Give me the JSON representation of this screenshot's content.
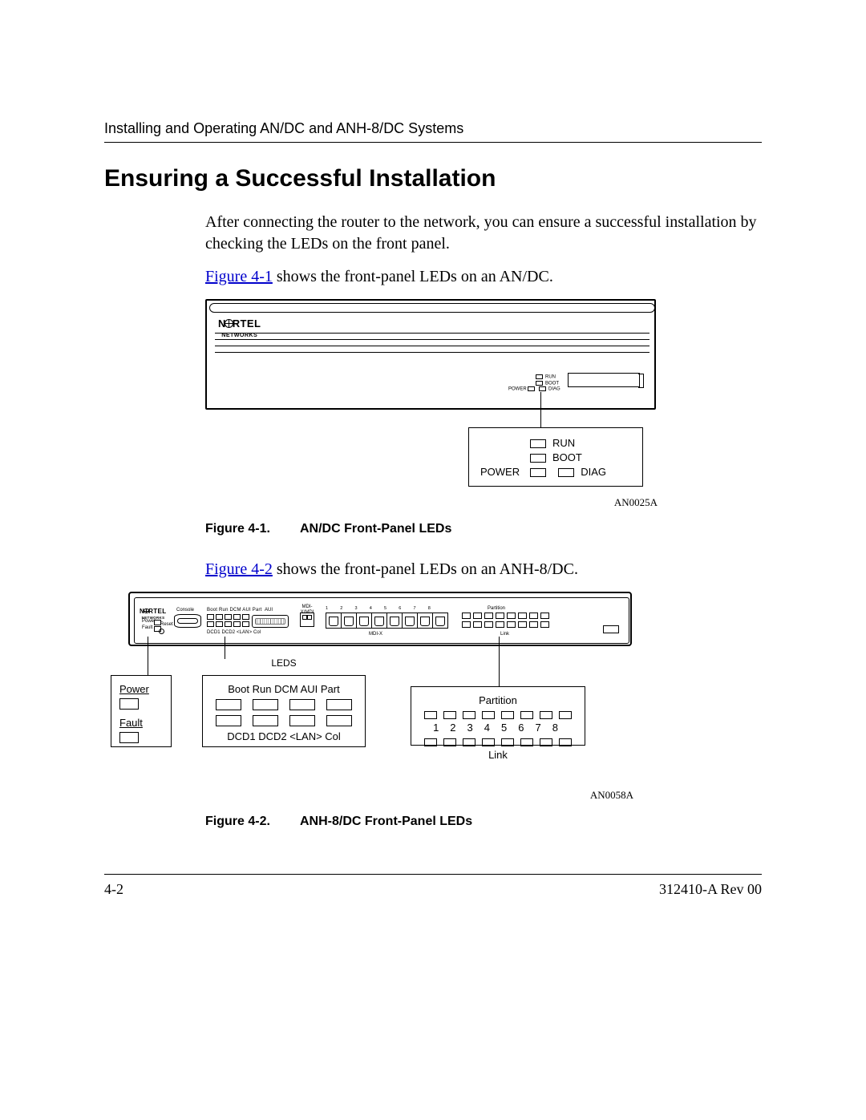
{
  "header": {
    "running_title": "Installing and Operating AN/DC and ANH-8/DC Systems"
  },
  "heading": "Ensuring a Successful Installation",
  "para1": "After connecting the router to the network, you can ensure a successful installation by checking the LEDs on the front panel.",
  "para2_pre_link": "",
  "para2_link": "Figure 4-1",
  "para2_post_link": " shows the front-panel LEDs on an AN/DC.",
  "para3_link": "Figure 4-2",
  "para3_post_link": " shows the front-panel LEDs on an ANH-8/DC.",
  "fig41": {
    "brand_line1_a": "N",
    "brand_line1_b": "RTEL",
    "brand_line2": "NETWORKS",
    "micro_power": "POWER",
    "micro_run": "RUN",
    "micro_boot": "BOOT",
    "micro_diag": "DIAG",
    "callout_power": "POWER",
    "callout_run": "RUN",
    "callout_boot": "BOOT",
    "callout_diag": "DIAG",
    "artcode": "AN0025A",
    "caption_num": "Figure 4-1.",
    "caption_text": "AN/DC Front-Panel LEDs"
  },
  "fig42": {
    "brand_line1_a": "N",
    "brand_line1_b": "RTEL",
    "brand_line2": "NETWORKS",
    "lbl_console": "Console",
    "lbl_power": "Power",
    "lbl_fault": "Fault",
    "lbl_reset": "Reset",
    "lbl_tiny_top": "Boot Run DCM AUI Part",
    "lbl_tiny_bot": "DCD1 DCD2 <LAN> Col",
    "lbl_aui": "AUI",
    "lbl_mdix": "MDI-X/MDI",
    "lbl_mdix_bar": "MDI-X",
    "rj_numbers": "12345678",
    "lbl_partition": "Partition",
    "lbl_link": "Link",
    "leds_title": "LEDS",
    "co_left_power": "Power",
    "co_left_fault": "Fault",
    "co_mid_top": "Boot  Run   DCM  AUI Part",
    "co_mid_bot": "DCD1 DCD2 <LAN>  Col",
    "co_right_partition": "Partition",
    "co_right_nums": "12345678",
    "co_right_link": "Link",
    "artcode": "AN0058A",
    "caption_num": "Figure 4-2.",
    "caption_text": "ANH-8/DC Front-Panel LEDs"
  },
  "footer": {
    "page": "4-2",
    "docid": "312410-A Rev 00"
  }
}
